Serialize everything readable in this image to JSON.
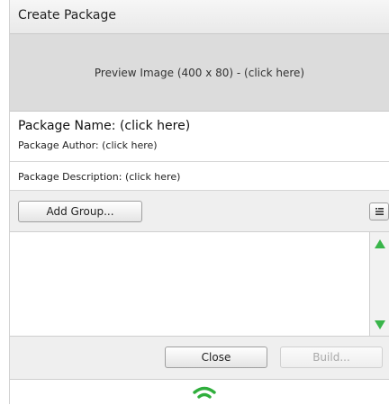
{
  "window": {
    "title": "Create Package"
  },
  "preview": {
    "label": "Preview Image (400 x 80) - (click here)"
  },
  "package": {
    "name": "Package Name: (click here)",
    "author": "Package Author: (click here)",
    "description": "Package Description: (click here)"
  },
  "toolbar": {
    "add_group_label": "Add Group...",
    "list_menu_icon": "list-menu-icon"
  },
  "scrollbar": {
    "up_icon": "arrow-up-icon",
    "down_icon": "arrow-down-icon",
    "arrow_color": "#39b54a"
  },
  "footer": {
    "close_label": "Close",
    "build_label": "Build..."
  },
  "status": {
    "icon": "wifi-signal-icon",
    "icon_color": "#2fae3c"
  }
}
